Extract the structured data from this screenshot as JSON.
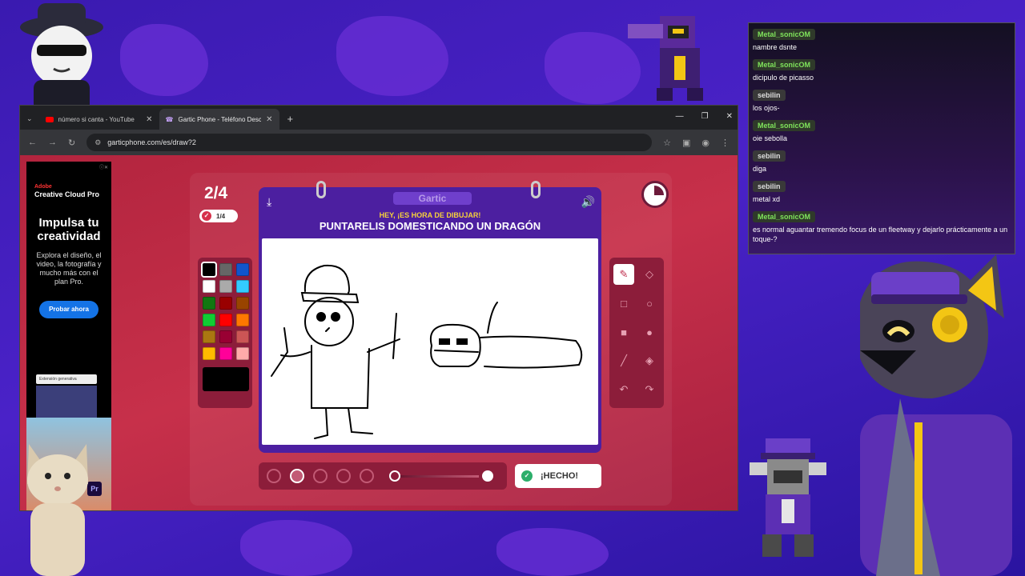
{
  "browser": {
    "tabs": [
      {
        "label": "número si canta - YouTube",
        "active": false
      },
      {
        "label": "Gartic Phone - Teléfono Descon",
        "active": true
      }
    ],
    "url": "garticphone.com/es/draw?2"
  },
  "ad": {
    "brand": "Adobe",
    "product": "Creative Cloud Pro",
    "headline": "Impulsa tu creatividad",
    "body": "Explora el diseño, el video, la fotografía y mucho más con el plan Pro.",
    "cta": "Probar ahora",
    "gen_label": "Extensión generativa",
    "app_badge": "Pr"
  },
  "game": {
    "round": "2/4",
    "progress": "1/4",
    "logo": "Gartic",
    "subtitle": "HEY, ¡ES HORA DE DIBUJAR!",
    "prompt": "PUNTARELIS DOMESTICANDO UN DRAGÓN",
    "done_label": "¡HECHO!",
    "palette": [
      "#000000",
      "#666666",
      "#1155cc",
      "#ffffff",
      "#aaaaaa",
      "#33ccff",
      "#117711",
      "#990000",
      "#994400",
      "#11cc33",
      "#ff0000",
      "#ff7700",
      "#aa7711",
      "#990033",
      "#cc5555",
      "#ffbb00",
      "#ff0099",
      "#ffaaaa"
    ],
    "tools": [
      "pencil-icon",
      "eraser-icon",
      "rectangle-icon",
      "ellipse-icon",
      "filled-rectangle-icon",
      "filled-ellipse-icon",
      "line-icon",
      "fill-icon",
      "undo-icon",
      "redo-icon"
    ]
  },
  "chat": [
    {
      "user": "Metal_sonicOM",
      "text": "nambre dsnte",
      "color": "green"
    },
    {
      "user": "Metal_sonicOM",
      "text": "dicipulo de picasso",
      "color": "green"
    },
    {
      "user": "sebilin",
      "text": "los ojos-",
      "color": "gray"
    },
    {
      "user": "Metal_sonicOM",
      "text": "oie sebolla",
      "color": "green"
    },
    {
      "user": "sebilin",
      "text": "diga",
      "color": "gray"
    },
    {
      "user": "sebilin",
      "text": "metal xd",
      "color": "gray"
    },
    {
      "user": "Metal_sonicOM",
      "text": "es normal aguantar tremendo focus de un fleetway y dejarlo prácticamente a un toque-?",
      "color": "green"
    }
  ]
}
